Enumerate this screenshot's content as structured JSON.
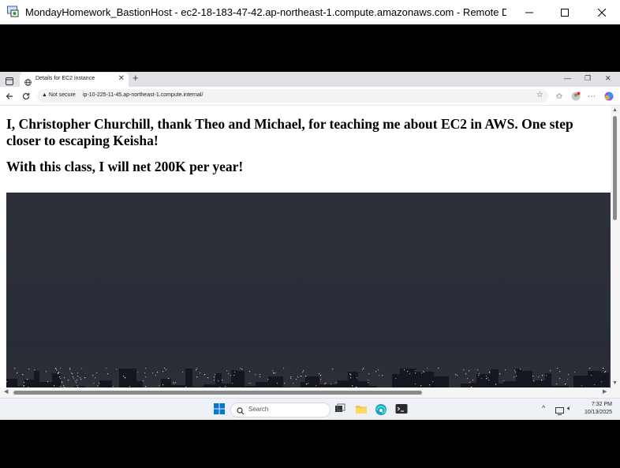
{
  "rdp_window": {
    "title": "MondayHomework_BastionHost - ec2-18-183-47-42.ap-northeast-1.compute.amazonaws.com - Remote Desktop...",
    "icon": "remote-desktop-icon"
  },
  "browser": {
    "tab": {
      "title": "Details for EC2 instance",
      "icon": "globe-icon"
    },
    "address_bar": {
      "security_label": "Not secure",
      "url": "ip-10-225-11-45.ap-northeast-1.compute.internal/"
    },
    "toolbar_icons": [
      "back-icon",
      "refresh-icon",
      "star-icon",
      "favorites-icon",
      "profile-icon",
      "more-icon",
      "copilot-icon"
    ]
  },
  "page": {
    "heading_1": "I, Christopher Churchill, thank Theo and Michael, for teaching me about EC2 in AWS. One step closer to escaping Keisha!",
    "heading_2": "With this class, I will net 200K per year!",
    "image": "night city skyline photo"
  },
  "taskbar": {
    "search_placeholder": "Search",
    "time": "7:32 PM",
    "date": "10/13/2025",
    "apps": [
      "windows-start-icon",
      "task-view-icon",
      "file-explorer-icon",
      "edge-icon",
      "terminal-icon"
    ]
  },
  "colors": {
    "accent": "#0067c0",
    "window_bg": "#ffffff",
    "desktop_band": "#000000"
  }
}
